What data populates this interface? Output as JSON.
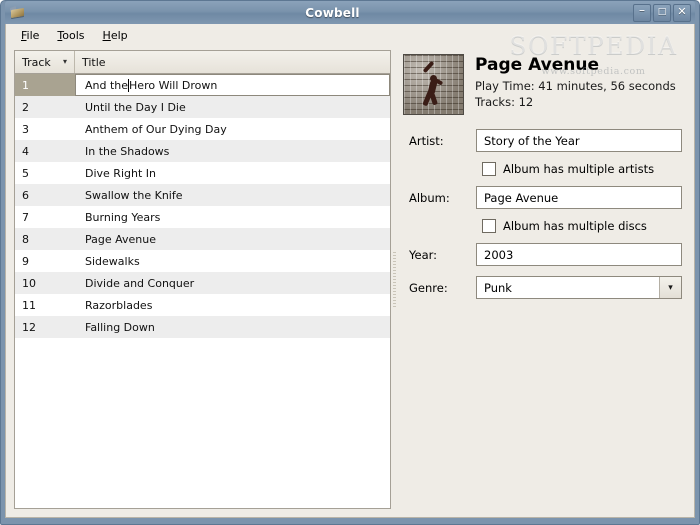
{
  "window": {
    "title": "Cowbell",
    "icon": "cowbell-icon",
    "controls": {
      "minimize": "–",
      "maximize": "□",
      "close": "✕"
    }
  },
  "watermark": {
    "main": "SOFTPEDIA",
    "sub": "www.softpedia.com"
  },
  "menubar": {
    "items": [
      {
        "label": "File",
        "mnemonic": "F",
        "rest": "ile"
      },
      {
        "label": "Tools",
        "mnemonic": "T",
        "rest": "ools"
      },
      {
        "label": "Help",
        "mnemonic": "H",
        "rest": "elp"
      }
    ]
  },
  "tracklist": {
    "columns": [
      {
        "label": "Track",
        "sorted": true,
        "sort_indicator": "▾"
      },
      {
        "label": "Title",
        "sorted": false,
        "sort_indicator": ""
      }
    ],
    "selected_index": 0,
    "editing_caret_after": "And the ",
    "rows": [
      {
        "track": "1",
        "title": "And the Hero Will Drown"
      },
      {
        "track": "2",
        "title": "Until the Day I Die"
      },
      {
        "track": "3",
        "title": "Anthem of Our Dying Day"
      },
      {
        "track": "4",
        "title": "In the Shadows"
      },
      {
        "track": "5",
        "title": "Dive Right In"
      },
      {
        "track": "6",
        "title": "Swallow the Knife"
      },
      {
        "track": "7",
        "title": "Burning Years"
      },
      {
        "track": "8",
        "title": "Page Avenue"
      },
      {
        "track": "9",
        "title": "Sidewalks"
      },
      {
        "track": "10",
        "title": "Divide and Conquer"
      },
      {
        "track": "11",
        "title": "Razorblades"
      },
      {
        "track": "12",
        "title": "Falling Down"
      }
    ]
  },
  "details": {
    "cover_art": "album-cover-art",
    "album_title": "Page Avenue",
    "play_time": "Play Time: 41 minutes, 56 seconds",
    "tracks_count": "Tracks: 12",
    "artist_label": "Artist:",
    "artist_value": "Story of the Year",
    "multiple_artists_label": "Album has multiple artists",
    "multiple_artists_checked": false,
    "album_label": "Album:",
    "album_value": "Page Avenue",
    "multiple_discs_label": "Album has multiple discs",
    "multiple_discs_checked": false,
    "year_label": "Year:",
    "year_value": "2003",
    "genre_label": "Genre:",
    "genre_value": "Punk",
    "genre_arrow": "▾"
  },
  "colors": {
    "titlebar": "#7a93ac",
    "window_frame": "#7c94ad",
    "client_bg": "#efece6",
    "row_alt": "#ededed",
    "selection": "#a9a391",
    "field_border": "#8e897e"
  }
}
